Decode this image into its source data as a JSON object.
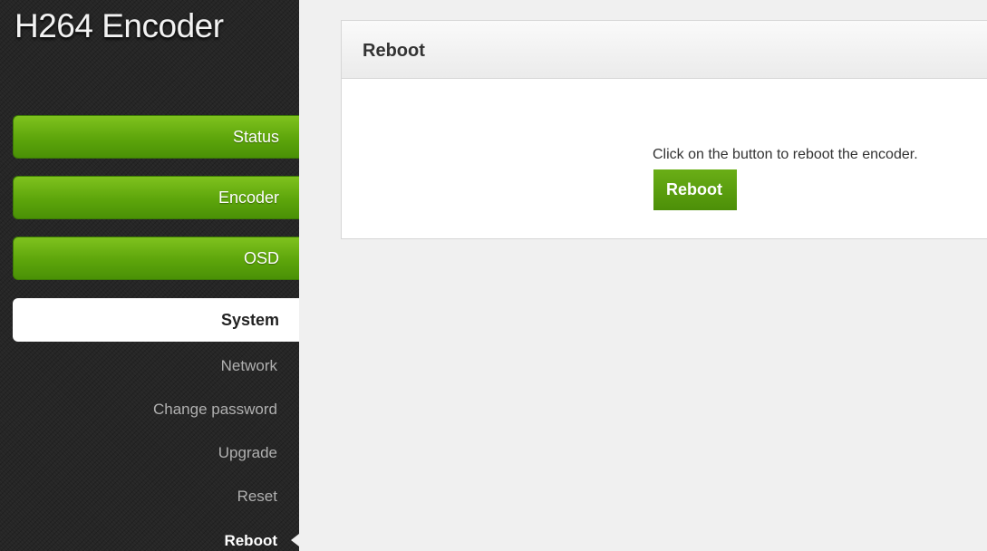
{
  "app": {
    "title": "H264 Encoder"
  },
  "sidebar": {
    "main_items": [
      {
        "label": "Status"
      },
      {
        "label": "Encoder"
      },
      {
        "label": "OSD"
      }
    ],
    "active_section": {
      "label": "System"
    },
    "sub_items": [
      {
        "label": "Network"
      },
      {
        "label": "Change password"
      },
      {
        "label": "Upgrade"
      },
      {
        "label": "Reset"
      },
      {
        "label": "Reboot",
        "current": true
      }
    ]
  },
  "panel": {
    "title": "Reboot",
    "description": "Click on the button to reboot the encoder.",
    "button_label": "Reboot"
  },
  "colors": {
    "accent_green": "#5da50b",
    "sidebar_bg": "#262626",
    "page_bg": "#f0f0f0"
  }
}
